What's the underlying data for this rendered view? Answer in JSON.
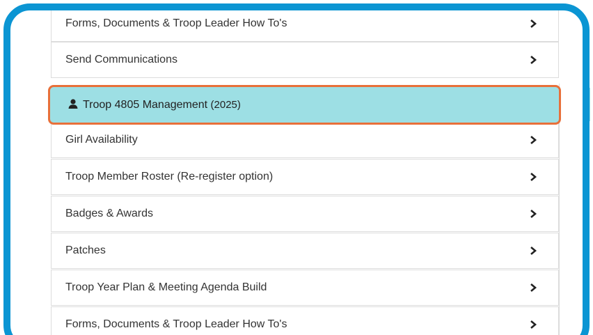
{
  "menu_top": [
    {
      "label": "Forms, Documents & Troop Leader How To's"
    },
    {
      "label": "Send Communications"
    }
  ],
  "section_header": {
    "icon": "user-icon",
    "title": "Troop 4805 Management",
    "year": "(2025)"
  },
  "menu_items": [
    {
      "label": "Girl Availability"
    },
    {
      "label": "Troop Member Roster (Re-register option)"
    },
    {
      "label": "Badges & Awards"
    },
    {
      "label": "Patches"
    },
    {
      "label": "Troop Year Plan & Meeting Agenda Build"
    },
    {
      "label": "Forms, Documents & Troop Leader How To's"
    }
  ],
  "colors": {
    "frame_border": "#0b95d3",
    "header_bg": "#9ddfe4",
    "header_outline": "#e8703a",
    "item_border": "#dcdcdc",
    "text": "#333333"
  }
}
